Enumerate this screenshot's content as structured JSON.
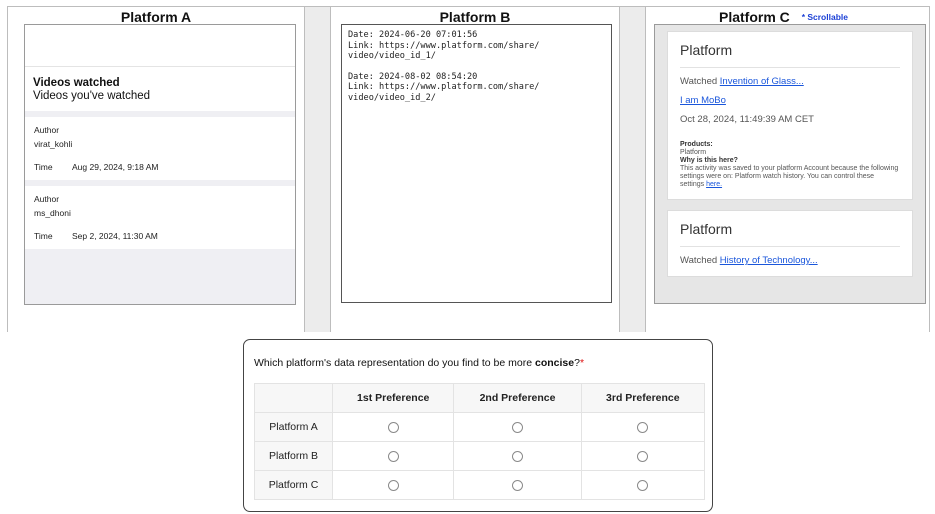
{
  "platform_a": {
    "title": "Platform A",
    "header_title": "Videos watched",
    "header_subtitle": "Videos you've watched",
    "entries": [
      {
        "author_label": "Author",
        "author": "virat_kohli",
        "time_label": "Time",
        "time": "Aug 29, 2024, 9:18 AM"
      },
      {
        "author_label": "Author",
        "author": "ms_dhoni",
        "time_label": "Time",
        "time": "Sep 2, 2024, 11:30 AM"
      }
    ]
  },
  "platform_b": {
    "title": "Platform B",
    "entries": [
      {
        "text": "Date: 2024-06-20 07:01:56\nLink: https://www.platform.com/share/\nvideo/video_id_1/"
      },
      {
        "text": "Date: 2024-08-02 08:54:20\nLink: https://www.platform.com/share/\nvideo/video_id_2/"
      }
    ]
  },
  "platform_c": {
    "title": "Platform C",
    "scroll_note": "* Scrollable",
    "cards": [
      {
        "title": "Platform",
        "watched_prefix": "Watched ",
        "watched_link": "Invention of Glass...",
        "channel_link": "I am MoBo",
        "timestamp": "Oct 28, 2024, 11:49:39 AM CET",
        "products_label": "Products:",
        "products_value": "Platform",
        "why_label": "Why is this here?",
        "why_text": "This activity was saved to your platform Account because the following settings were on: Platform watch history. You can control these settings",
        "here_link": "here."
      },
      {
        "title": "Platform",
        "watched_prefix": "Watched ",
        "watched_link": "History of Technology..."
      }
    ]
  },
  "question": {
    "text_prefix": "Which platform's data representation do you find to be more ",
    "text_bold": "concise",
    "text_suffix": "?",
    "required_mark": "*",
    "columns": [
      "1st Preference",
      "2nd Preference",
      "3rd Preference"
    ],
    "rows": [
      "Platform A",
      "Platform B",
      "Platform C"
    ]
  },
  "colors": {
    "link": "#1a56db",
    "required": "#dd1111",
    "scroll_note": "#1a3fd6"
  }
}
